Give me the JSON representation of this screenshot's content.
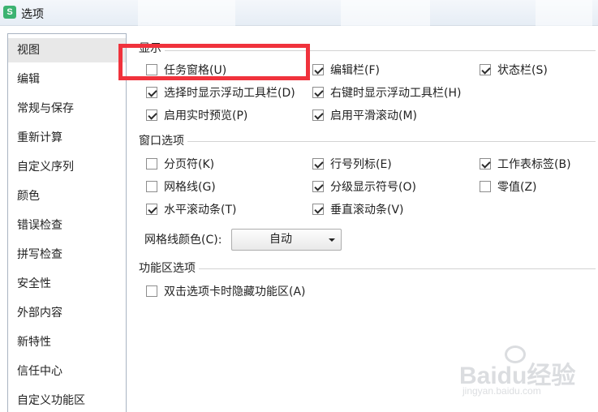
{
  "window": {
    "app_icon": "S",
    "title": "选项"
  },
  "sidebar": {
    "items": [
      {
        "label": "视图",
        "selected": true
      },
      {
        "label": "编辑"
      },
      {
        "label": "常规与保存"
      },
      {
        "label": "重新计算"
      },
      {
        "label": "自定义序列"
      },
      {
        "label": "颜色"
      },
      {
        "label": "错误检查"
      },
      {
        "label": "拼写检查"
      },
      {
        "label": "安全性"
      },
      {
        "label": "外部内容"
      },
      {
        "label": "新特性"
      },
      {
        "label": "信任中心"
      },
      {
        "label": "自定义功能区"
      }
    ]
  },
  "display": {
    "heading": "显示",
    "options": [
      {
        "label": "任务窗格(U)",
        "checked": false
      },
      {
        "label": "编辑栏(F)",
        "checked": true
      },
      {
        "label": "状态栏(S)",
        "checked": true
      },
      {
        "label": "选择时显示浮动工具栏(D)",
        "checked": true
      },
      {
        "label": "右键时显示浮动工具栏(H)",
        "checked": true
      },
      {
        "label": "启用实时预览(P)",
        "checked": true
      },
      {
        "label": "启用平滑滚动(M)",
        "checked": true
      }
    ]
  },
  "window_options": {
    "heading": "窗口选项",
    "options": [
      {
        "label": "分页符(K)",
        "checked": false
      },
      {
        "label": "行号列标(E)",
        "checked": true
      },
      {
        "label": "工作表标签(B)",
        "checked": true
      },
      {
        "label": "网格线(G)",
        "checked": false
      },
      {
        "label": "分级显示符号(O)",
        "checked": true
      },
      {
        "label": "零值(Z)",
        "checked": false
      },
      {
        "label": "水平滚动条(T)",
        "checked": true
      },
      {
        "label": "垂直滚动条(V)",
        "checked": true
      }
    ],
    "gridline_color_label": "网格线颜色(C):",
    "gridline_color_value": "自动"
  },
  "ribbon": {
    "heading": "功能区选项",
    "options": [
      {
        "label": "双击选项卡时隐藏功能区(A)",
        "checked": false
      }
    ]
  },
  "watermark": {
    "main": "Baidu经验",
    "sub": "jingyan.baidu.com"
  },
  "colors": {
    "highlight_box": "#f0323c",
    "app_icon": "#3cb371"
  }
}
